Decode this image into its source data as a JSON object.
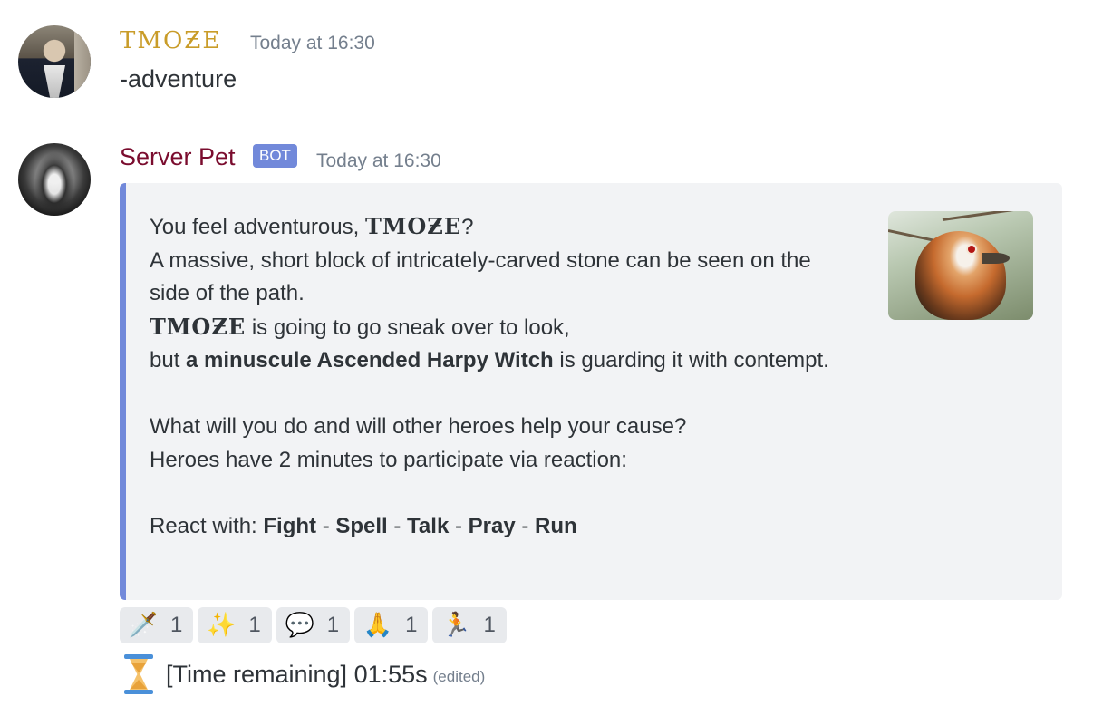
{
  "messages": [
    {
      "username": "TMOƵE",
      "timestamp": "Today at 16:30",
      "text": "-adventure"
    },
    {
      "username": "Server Pet",
      "bot_tag": "BOT",
      "timestamp": "Today at 16:30",
      "embed": {
        "accent_color": "#7289da",
        "line1_prefix": "You feel adventurous, ",
        "line1_name": "TMOƵE",
        "line1_suffix": "?",
        "line2": "A massive, short block of intricately-carved stone can be seen on the side of the path.",
        "line3_name": "TMOƵE",
        "line3_suffix": " is going to go sneak over to look,",
        "line4_prefix": "but ",
        "line4_bold": "a minuscule Ascended Harpy Witch",
        "line4_suffix": " is guarding it with contempt.",
        "line5": "What will you do and will other heroes help your cause?",
        "line6": "Heroes have 2 minutes to participate via reaction:",
        "react_prefix": "React with: ",
        "actions": [
          "Fight",
          "Spell",
          "Talk",
          "Pray",
          "Run"
        ],
        "separator": " - ",
        "thumbnail_icon": "vulture-photo"
      },
      "reactions": [
        {
          "icon": "dagger-icon",
          "glyph": "🗡️",
          "count": "1"
        },
        {
          "icon": "sparkles-icon",
          "glyph": "✨",
          "count": "1"
        },
        {
          "icon": "speech-bubble-icon",
          "glyph": "💬",
          "count": "1"
        },
        {
          "icon": "praying-hands-icon",
          "glyph": "🙏",
          "count": "1"
        },
        {
          "icon": "running-person-icon",
          "glyph": "🏃",
          "count": "1"
        }
      ],
      "timer": {
        "icon": "hourglass-icon",
        "text": "[Time remaining] 01:55s",
        "edited": "(edited)"
      }
    }
  ],
  "colors": {
    "user1": "#c99c29",
    "user2": "#7a0c2e",
    "bot_tag": "#7289da",
    "embed_bg": "#f2f3f5",
    "timestamp": "#747f8d"
  }
}
